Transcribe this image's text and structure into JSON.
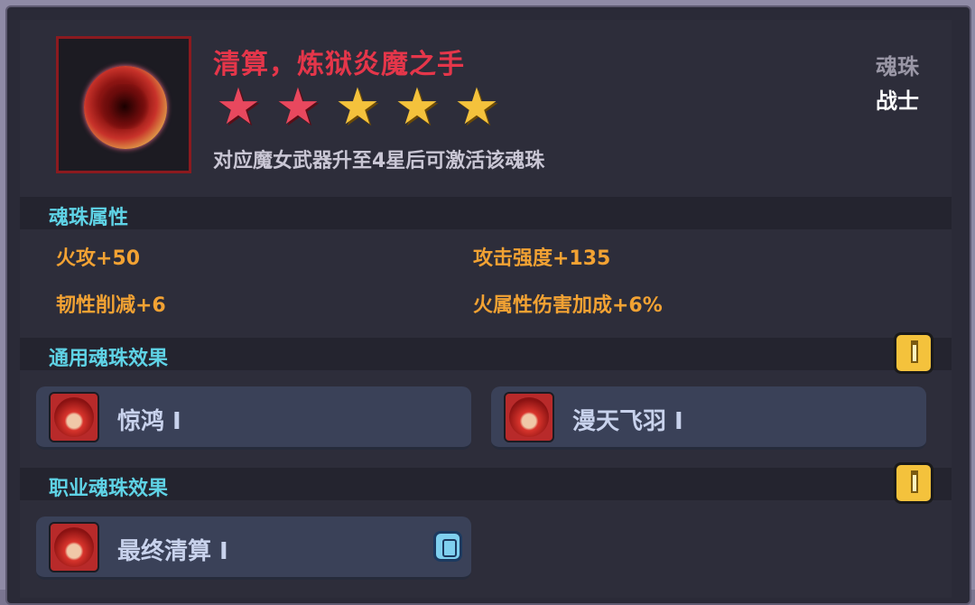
{
  "item": {
    "name": "清算，炼狱炎魔之手",
    "hint": "对应魔女武器升至4星后可激活该魂珠",
    "type_label": "魂珠",
    "class_label": "战士",
    "stars": {
      "total": 5,
      "red": 2,
      "gold": 3
    }
  },
  "attributes_section": {
    "title": "魂珠属性",
    "attrs": [
      "火攻+50",
      "攻击强度+135",
      "韧性削减+6",
      "火属性伤害加成+6%"
    ]
  },
  "general_section": {
    "title": "通用魂珠效果",
    "effects": [
      "惊鸿 Ⅰ",
      "漫天飞羽 Ⅰ"
    ]
  },
  "class_section": {
    "title": "职业魂珠效果",
    "effects": [
      "最终清算 Ⅰ"
    ]
  },
  "colors": {
    "title_red": "#e5364a",
    "section_cyan": "#5fd3e6",
    "attr_orange": "#f2a233",
    "star_gold": "#f4c23c",
    "star_red": "#e8485e"
  },
  "icons": {
    "orb": "fire-soul-orb-icon",
    "info": "info-icon",
    "effect": "red-hair-portrait-icon",
    "gem": "blue-gem-icon"
  }
}
